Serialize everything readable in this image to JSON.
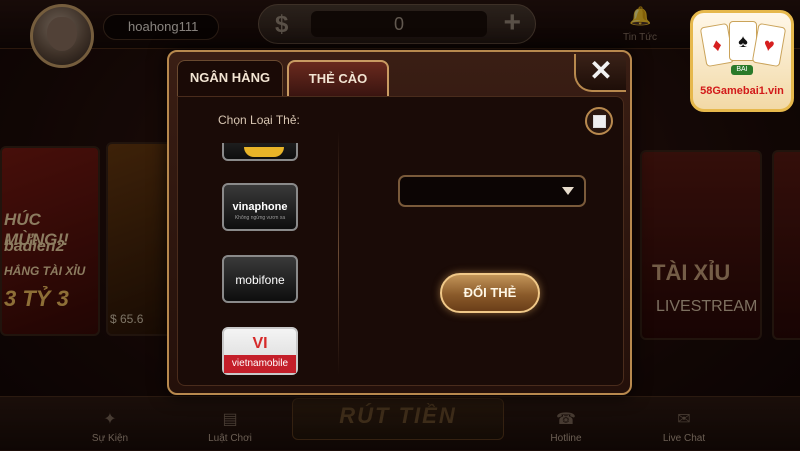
{
  "topbar": {
    "username": "hoahong111",
    "balance": "0",
    "balance_currency_icon": "dollar-icon",
    "add_icon": "plus-icon",
    "news_label": "Tin Tức"
  },
  "background": {
    "left_card_lines": [
      "HÚC MỪNG!!",
      "badien2",
      "HẮNG TÀI XỈU",
      "3 TỶ 3"
    ],
    "left_price": "$ 65.6",
    "right_card_title": "TÀI XỈU",
    "right_card_subtitle": "LIVESTREAM"
  },
  "bottom_nav": {
    "items": [
      {
        "label": "Sự Kiện",
        "icon": "party-popper-icon"
      },
      {
        "label": "Luật Chơi",
        "icon": "rulebook-icon"
      },
      {
        "label": "Hotline",
        "icon": "telephone-icon"
      },
      {
        "label": "Live Chat",
        "icon": "chat-bubble-icon"
      }
    ],
    "center_label": "RÚT TIỀN"
  },
  "dialog": {
    "tabs": [
      {
        "label": "NGÂN HÀNG",
        "active": false
      },
      {
        "label": "THẺ CÀO",
        "active": true
      }
    ],
    "close_label": "✕",
    "select_card_label": "Chọn Loại Thẻ:",
    "carriers": [
      {
        "name": "vinaphone",
        "slogan": "Không ngừng vươn xa"
      },
      {
        "name": "mobifone",
        "slogan": ""
      },
      {
        "name": "vietnamobile",
        "mark": "VI"
      }
    ],
    "amount_select_value": "",
    "submit_label": "ĐỔI THẺ"
  },
  "brand": {
    "site": "58Gamebai1.vin",
    "chip": "BAI"
  },
  "colors": {
    "gold_border": "#b8894e",
    "dialog_bg": "#1a0b07",
    "button_gold": "#c29458",
    "brand_red": "#d21a1a"
  }
}
